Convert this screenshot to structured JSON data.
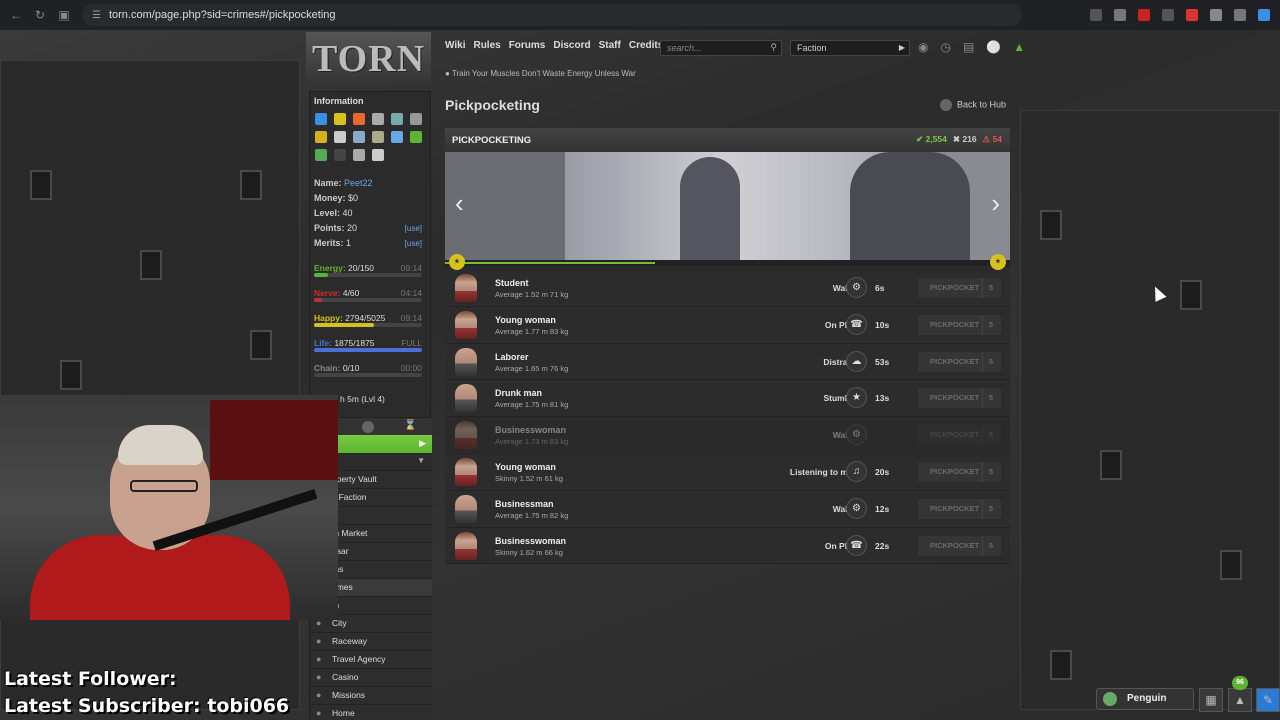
{
  "browser": {
    "url": "torn.com/page.php?sid=crimes#/pickpocketing"
  },
  "header": {
    "logo_text": "TORN",
    "nav": [
      "Wiki",
      "Rules",
      "Forums",
      "Discord",
      "Staff",
      "Credits"
    ],
    "search_placeholder": "search...",
    "faction_select": "Faction",
    "tip": "Train Your Muscles Don't Waste Energy Unless War"
  },
  "sidebar": {
    "title": "Information",
    "name_label": "Name:",
    "name_value": "Peet22",
    "money_label": "Money:",
    "money_value": "$0",
    "level_label": "Level:",
    "level_value": "40",
    "points_label": "Points:",
    "points_value": "20",
    "merits_label": "Merits:",
    "merits_value": "1",
    "use_label": "[use]",
    "bars": [
      {
        "label": "Energy:",
        "value": "20/150",
        "time": "09:14",
        "color": "#5cb531",
        "fill_pct": 13
      },
      {
        "label": "Nerve:",
        "value": "4/60",
        "time": "04:14",
        "color": "#c9302c",
        "fill_pct": 7
      },
      {
        "label": "Happy:",
        "value": "2794/5025",
        "time": "09:14",
        "color": "#d6c21a",
        "fill_pct": 56
      },
      {
        "label": "Life:",
        "value": "1875/1875",
        "time": "FULL",
        "color": "#4a6fd6",
        "fill_pct": 100
      },
      {
        "label": "Chain:",
        "value": "0/10",
        "time": "00:00",
        "color": "#888888",
        "fill_pct": 0
      }
    ],
    "partial": "h 5m (Lvl 4)",
    "menu": [
      "operty Vault",
      "y Faction",
      "b",
      "m Market",
      "zaar",
      "ms",
      "rimes",
      "m",
      "City",
      "Raceway",
      "Travel Agency",
      "Casino",
      "Missions",
      "Home"
    ]
  },
  "main": {
    "title": "Pickpocketing",
    "back_to_hub": "Back to Hub",
    "panel_title": "PICKPOCKETING",
    "stat_success": "2,554",
    "stat_fail": "216",
    "stat_critical": "54",
    "button_label": "PICKPOCKET",
    "button_cost": "5",
    "targets": [
      {
        "name": "Student",
        "desc": "Average 1.52 m 71 kg",
        "status": "Walking",
        "icon": "⚙",
        "time": "6s",
        "female": true,
        "dim": false
      },
      {
        "name": "Young woman",
        "desc": "Average 1.77 m 83 kg",
        "status": "On Phone",
        "icon": "☎",
        "time": "10s",
        "female": true,
        "dim": false
      },
      {
        "name": "Laborer",
        "desc": "Average 1.65 m 76 kg",
        "status": "Distracted",
        "icon": "☁",
        "time": "53s",
        "female": false,
        "dim": false
      },
      {
        "name": "Drunk man",
        "desc": "Average 1.75 m 81 kg",
        "status": "Stumbling",
        "icon": "★",
        "time": "13s",
        "female": false,
        "dim": false
      },
      {
        "name": "Businesswoman",
        "desc": "Average 1.73 m 83 kg",
        "status": "Walking",
        "icon": "⚙",
        "time": "",
        "female": true,
        "dim": true
      },
      {
        "name": "Young woman",
        "desc": "Skinny 1.52 m 61 kg",
        "status": "Listening to music",
        "icon": "♫",
        "time": "20s",
        "female": true,
        "dim": false
      },
      {
        "name": "Businessman",
        "desc": "Average 1.75 m 82 kg",
        "status": "Walking",
        "icon": "⚙",
        "time": "12s",
        "female": false,
        "dim": false
      },
      {
        "name": "Businesswoman",
        "desc": "Skinny 1.62 m 66 kg",
        "status": "On Phone",
        "icon": "☎",
        "time": "22s",
        "female": true,
        "dim": false
      }
    ]
  },
  "overlay": {
    "line1": "Latest Follower:",
    "line2": "Latest Subscriber: tobi066"
  },
  "bottom": {
    "chat_name": "Penguin",
    "badge": "96"
  }
}
